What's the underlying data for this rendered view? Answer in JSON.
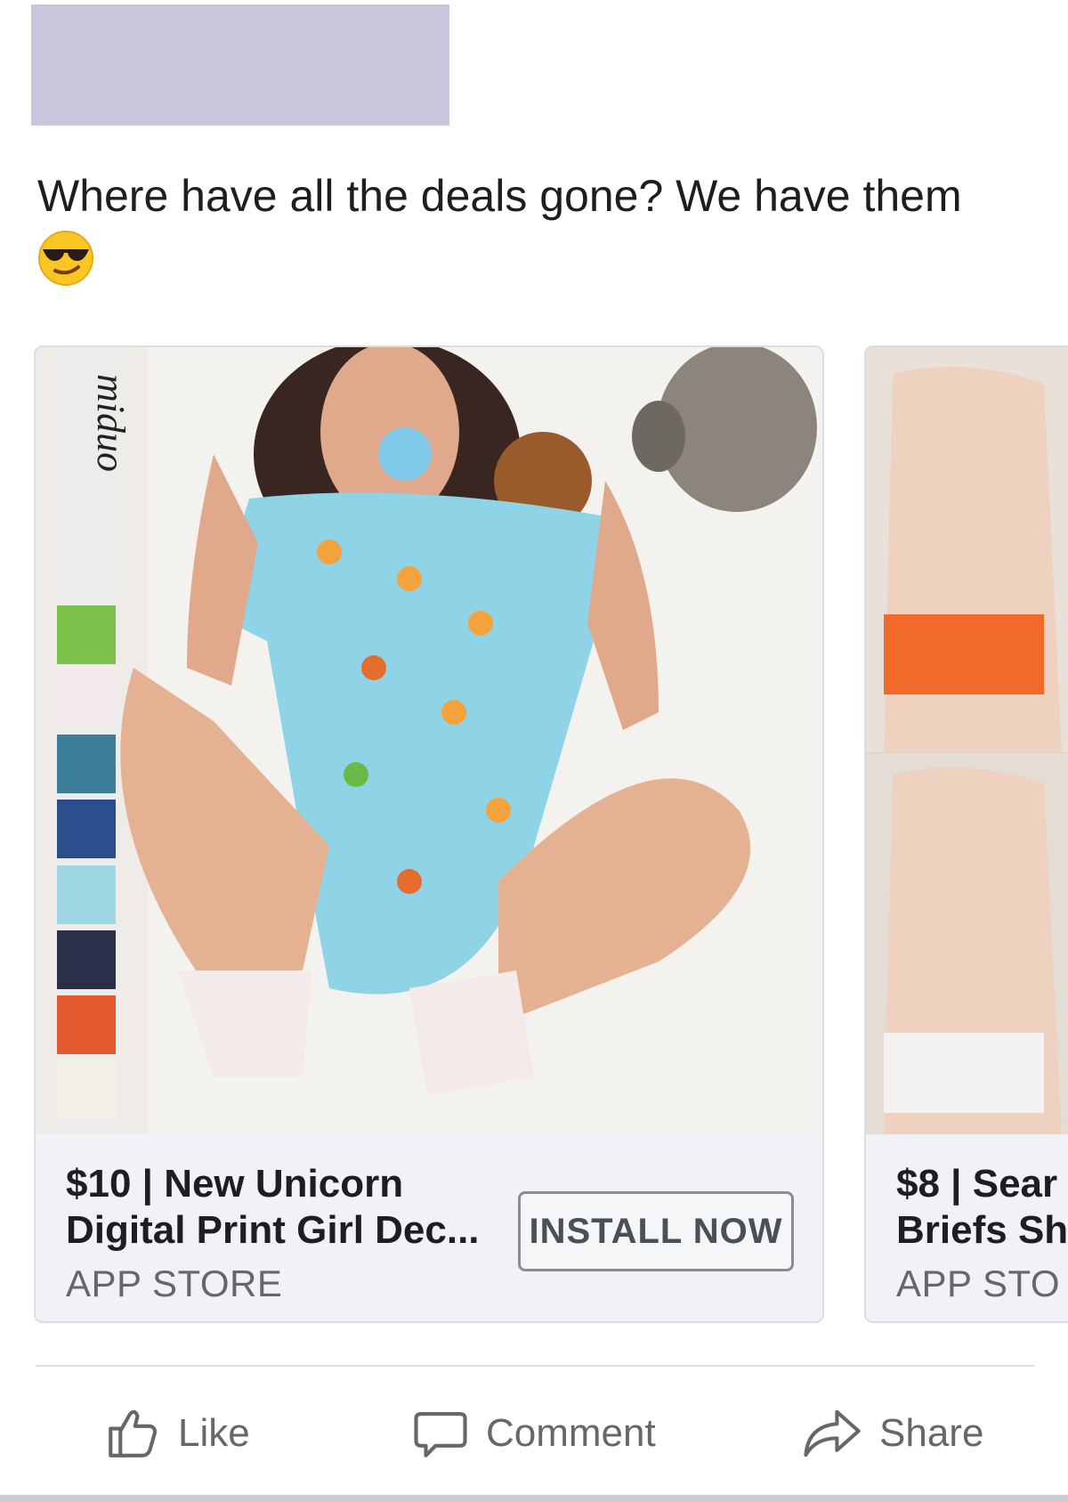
{
  "post": {
    "text": "Where have all the deals gone? We have them",
    "emoji_icon": "sunglasses-emoji-icon"
  },
  "cards": [
    {
      "image_label": "miduo",
      "price": "$10",
      "title_rest": "New Unicorn",
      "title_line2": "Digital Print Girl Dec...",
      "source": "APP STORE",
      "cta": "INSTALL NOW"
    },
    {
      "price": "$8",
      "title_rest": "Sear",
      "title_line2": "Briefs Sh",
      "source": "APP STO"
    }
  ],
  "actions": {
    "like": "Like",
    "comment": "Comment",
    "share": "Share"
  },
  "colors": {
    "redaction": "#c8c7de",
    "secondary_text": "#65676b",
    "card_bg": "#f0f2f5"
  }
}
